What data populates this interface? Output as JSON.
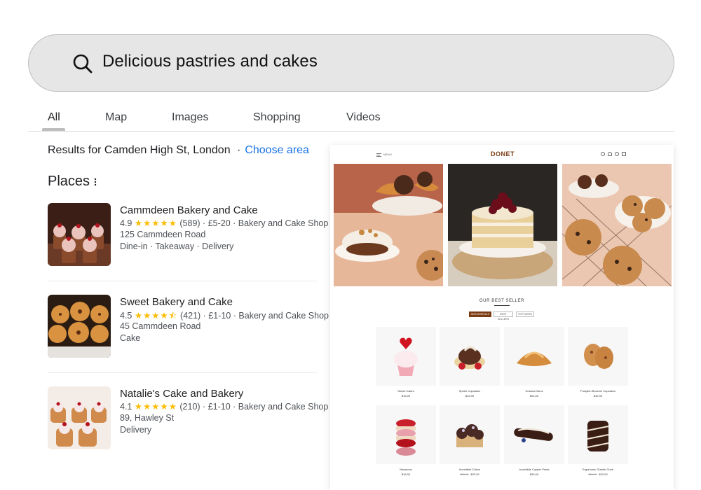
{
  "search": {
    "query": "Delicious pastries and cakes",
    "icon": "search-icon"
  },
  "tabs": [
    {
      "label": "All",
      "active": true
    },
    {
      "label": "Map"
    },
    {
      "label": "Images"
    },
    {
      "label": "Shopping"
    },
    {
      "label": "Videos"
    }
  ],
  "results": {
    "prefix": "Results for Camden High St, London",
    "choose_area": "Choose area"
  },
  "places": {
    "title": "Places",
    "items": [
      {
        "name": "Cammdeen Bakery and Cake",
        "rating": "4.9",
        "stars": "★★★★★",
        "reviews": "(589)",
        "price": "£5-20",
        "category": "Bakery and Cake Shop",
        "address": "125 Cammdeen Road",
        "services": "Dine-in · Takeaway · Delivery"
      },
      {
        "name": "Sweet Bakery and Cake",
        "rating": "4.5",
        "stars": "★★★★⯪",
        "reviews": "(421)",
        "price": "£1-10",
        "category": "Bakery and Cake Shop",
        "address": "45 Cammdeen Road",
        "services": "Cake"
      },
      {
        "name": "Natalie's Cake and Bakery",
        "rating": "4.1",
        "stars": "★★★★★",
        "reviews": "(210)",
        "price": "£1-10",
        "category": "Bakery and Cake Shop",
        "address": "89, Hawley St",
        "services": "Delivery"
      }
    ]
  },
  "website": {
    "menu_label": "MENU",
    "logo": "DONET",
    "section_title": "OUR BEST SELLER",
    "filters": [
      "NEW ARRIVALS",
      "BEST SELLERS",
      "TOP RATED"
    ],
    "products": [
      {
        "name": "Sweet Cakes",
        "price": "$15.00",
        "old_price": ""
      },
      {
        "name": "Spider Cupcakes",
        "price": "$15.00",
        "old_price": ""
      },
      {
        "name": "Sesame Buns",
        "price": "$24.00",
        "old_price": ""
      },
      {
        "name": "Pumpkin Brownie Cupcakes",
        "price": "$32.00",
        "old_price": ""
      },
      {
        "name": "Macarons",
        "price": "$16.00",
        "old_price": ""
      },
      {
        "name": "Incredible Cotton",
        "price": "$23.00",
        "old_price": "$35.00"
      },
      {
        "name": "Incredible Copper Pants",
        "price": "$26.00",
        "old_price": ""
      },
      {
        "name": "Ergonomic Granite Chair",
        "price": "$23.00",
        "old_price": "$35.00"
      }
    ]
  },
  "colors": {
    "accent_link": "#1a73e8",
    "star": "#fbbc04",
    "brand": "#7a3b12"
  }
}
